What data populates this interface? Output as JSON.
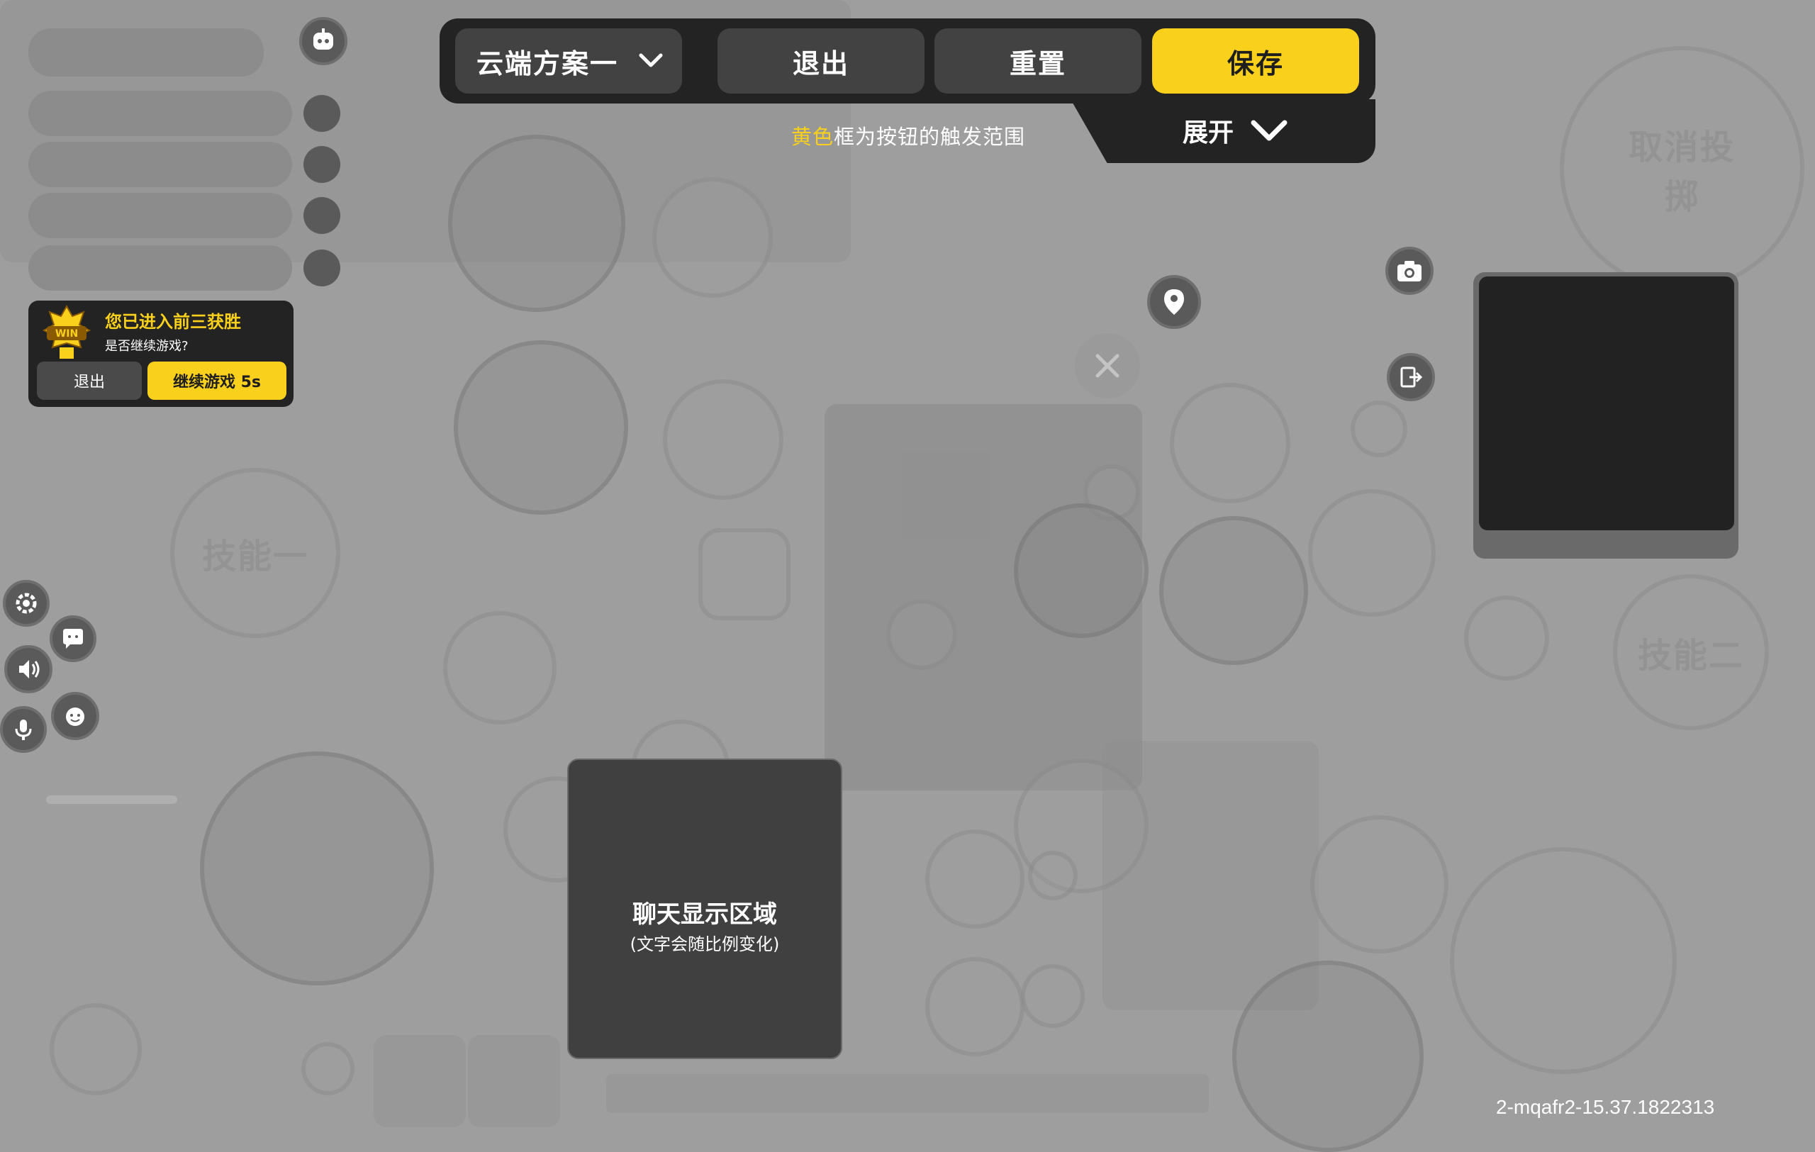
{
  "toolbar": {
    "plan_select_label": "云端方案一",
    "exit_label": "退出",
    "reset_label": "重置",
    "save_label": "保存",
    "expand_label": "展开"
  },
  "hint": {
    "highlight": "黄色",
    "rest": "框为按钮的触发范围"
  },
  "win_popup": {
    "badge": "WIN",
    "title": "您已进入前三获胜",
    "subtitle": "是否继续游戏?",
    "exit_label": "退出",
    "continue_label": "继续游戏 5s"
  },
  "chat_area": {
    "title": "聊天显示区域",
    "subtitle": "(文字会随比例变化)"
  },
  "ghost_labels": {
    "skill_one": "技能一",
    "skill_two": "技能二",
    "cancel_throw": "取消投掷"
  },
  "version": "2-mqafr2-15.37.1822313",
  "icons": [
    "robot-icon",
    "settings-icon",
    "chat-bubble-icon",
    "speaker-icon",
    "mic-icon",
    "emote-icon",
    "location-pin-icon",
    "camera-icon",
    "exit-door-icon",
    "close-icon",
    "chevron-down-icon"
  ],
  "colors": {
    "accent": "#f9d01c",
    "panel": "#232323",
    "button": "#424242"
  }
}
